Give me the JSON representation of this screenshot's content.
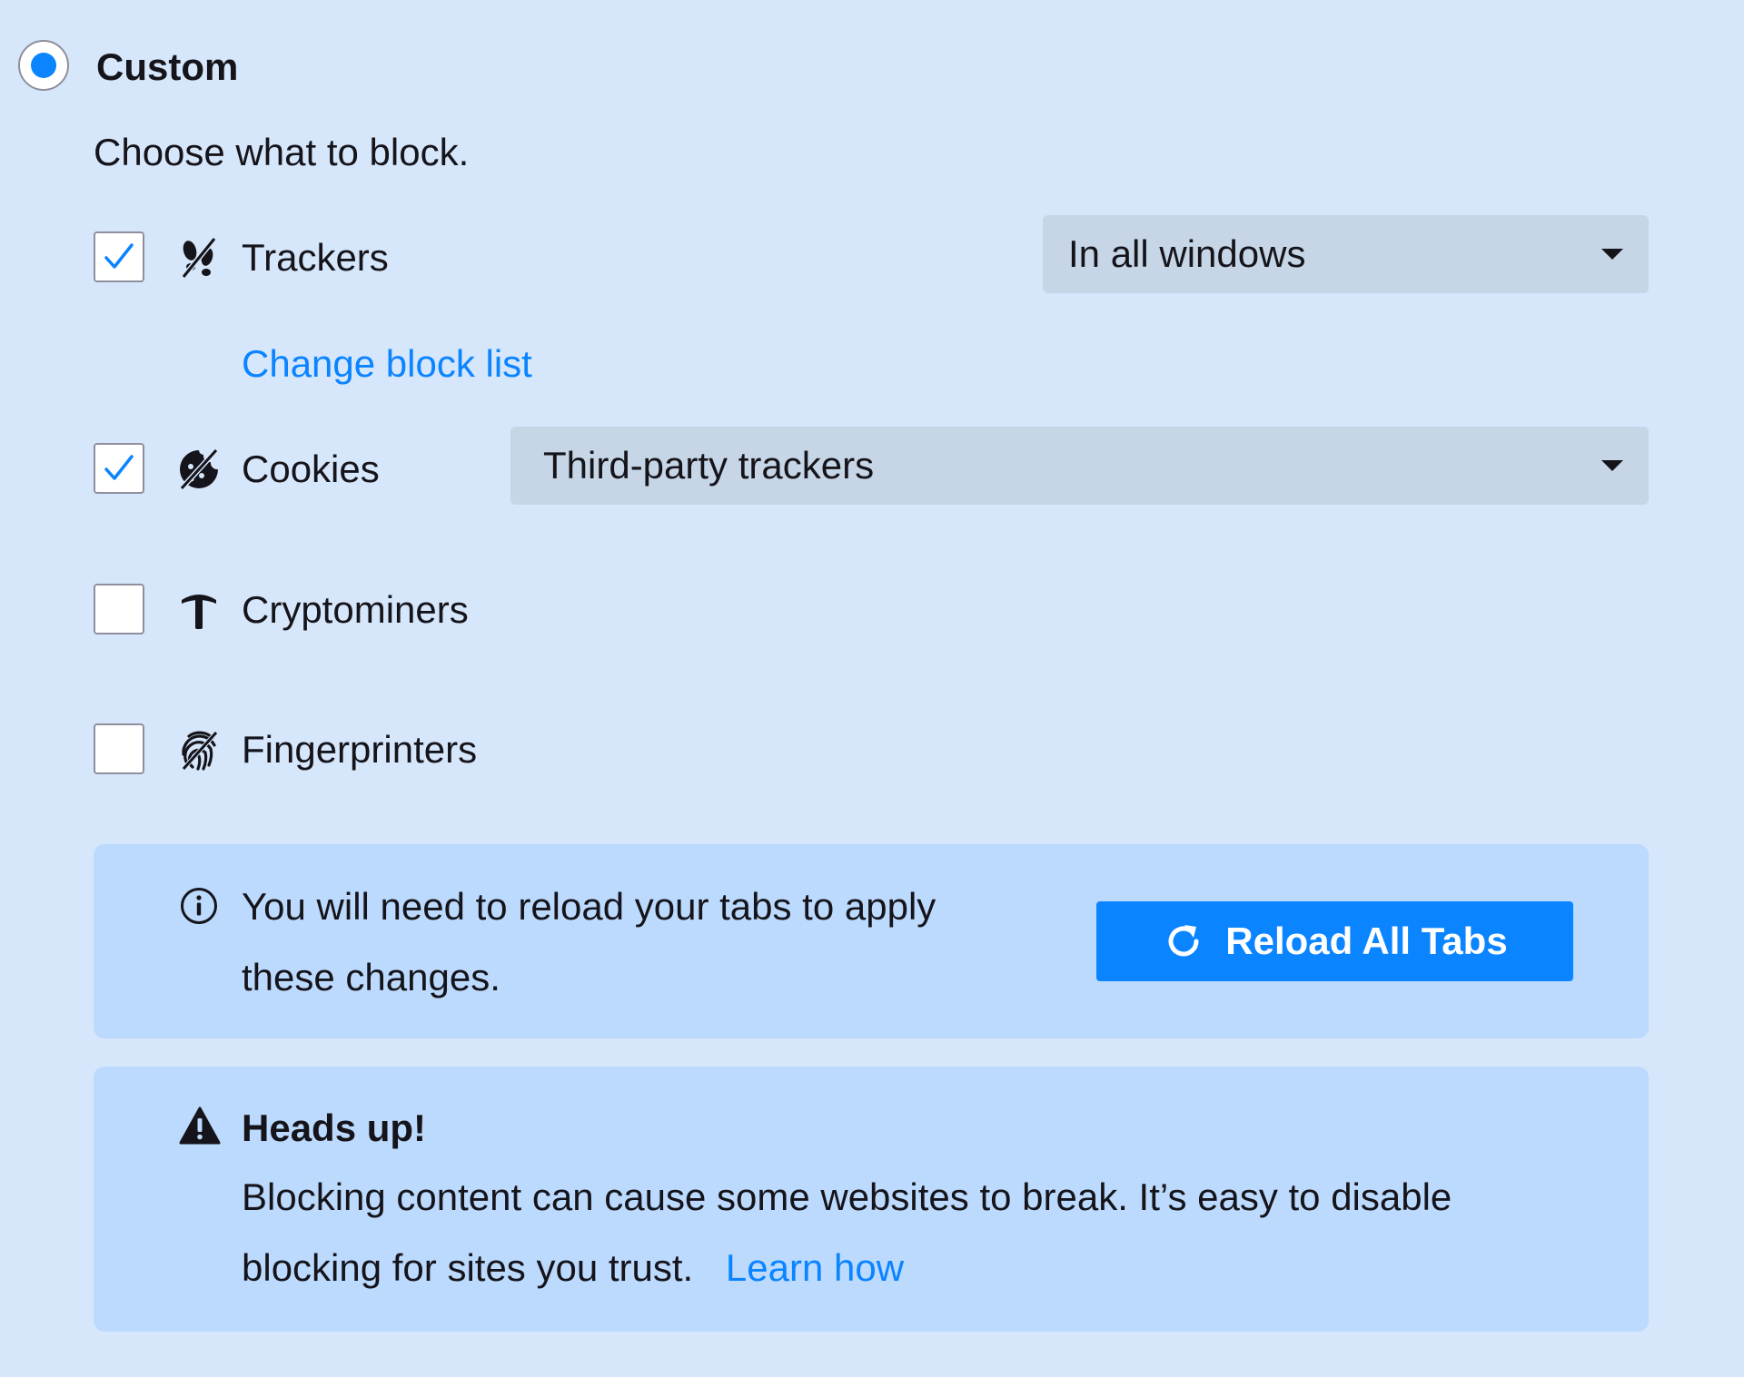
{
  "option": {
    "label": "Custom",
    "selected": true,
    "description": "Choose what to block."
  },
  "categories": [
    {
      "label": "Trackers",
      "checked": true,
      "icon": "tracker-icon"
    },
    {
      "label": "Cookies",
      "checked": true,
      "icon": "cookie-icon"
    },
    {
      "label": "Cryptominers",
      "checked": false,
      "icon": "cryptominer-icon"
    },
    {
      "label": "Fingerprinters",
      "checked": false,
      "icon": "fingerprint-icon"
    }
  ],
  "trackers_scope": {
    "selected": "In all windows"
  },
  "change_block_list_label": "Change block list",
  "cookies_scope": {
    "selected": "Third-party trackers"
  },
  "reload_notice": {
    "icon": "info-icon",
    "line1": "You will need to reload your tabs to apply",
    "line2": "these changes.",
    "button_label": "Reload All Tabs",
    "button_icon": "reload-icon"
  },
  "warning": {
    "icon": "warning-icon",
    "title": "Heads up!",
    "line1": "Blocking content can cause some websites to break. It’s easy to disable",
    "line2": "blocking for sites you trust.",
    "link_label": "Learn how"
  },
  "colors": {
    "background": "#d6e6fb",
    "accent": "#0a84ff",
    "dropdown_bg": "#c6d6e6",
    "box_bg": "#bcdafe"
  }
}
